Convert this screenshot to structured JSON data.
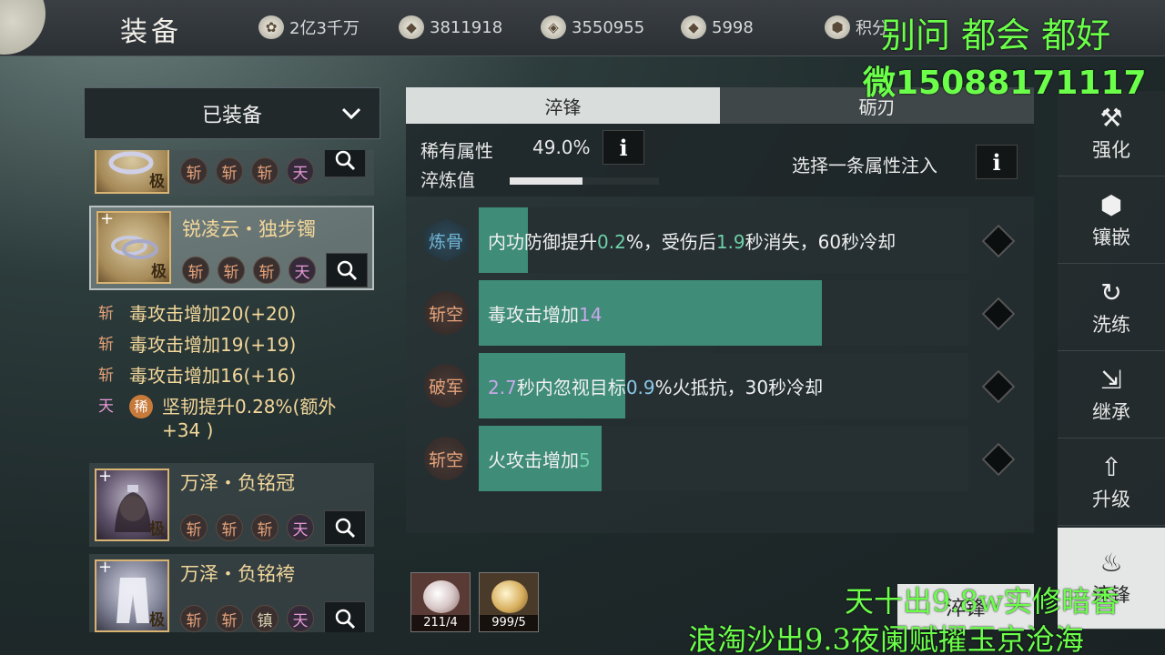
{
  "header": {
    "title": "装备",
    "currencies": [
      {
        "icon": "coin-icon",
        "glyph": "✿",
        "value": "2亿3千万"
      },
      {
        "icon": "silver-ingot-icon",
        "glyph": "◆",
        "value": "3811918"
      },
      {
        "icon": "jade-icon",
        "glyph": "◈",
        "value": "3550955"
      },
      {
        "icon": "gold-ingot-icon",
        "glyph": "◆",
        "value": "5998"
      },
      {
        "icon": "points-icon",
        "glyph": "⬢",
        "value": "积分"
      }
    ]
  },
  "left": {
    "dropdown_label": "已装备",
    "items": [
      {
        "name": "",
        "grade": "极",
        "slots": [
          "斩",
          "斩",
          "斩",
          "天"
        ]
      },
      {
        "name": "锐凌云・独步镯",
        "grade": "极",
        "slots": [
          "斩",
          "斩",
          "斩",
          "天"
        ]
      },
      {
        "name": "万泽・负铭冠",
        "grade": "极",
        "slots": [
          "斩",
          "斩",
          "斩",
          "天"
        ]
      },
      {
        "name": "万泽・负铭袴",
        "grade": "极",
        "slots": [
          "斩",
          "斩",
          "镇",
          "天"
        ]
      }
    ],
    "stats": [
      {
        "tag": "斩",
        "text": "毒攻击增加20(+20)"
      },
      {
        "tag": "斩",
        "text": "毒攻击增加19(+19)"
      },
      {
        "tag": "斩",
        "text": "毒攻击增加16(+16)"
      },
      {
        "tag": "天",
        "rare": "稀",
        "text": "坚韧提升0.28%(额外+34 )"
      }
    ]
  },
  "center": {
    "tabs": [
      "淬锋",
      "砺刃"
    ],
    "rare_attr_label": "稀有属性",
    "rare_attr_value": "49.0%",
    "temper_label": "淬炼值",
    "temper_progress": 0.49,
    "select_hint": "选择一条属性注入",
    "info_glyph": "i",
    "rows": [
      {
        "label": "炼骨",
        "fill": 0.1,
        "parts": [
          [
            "内功防御提升",
            ""
          ],
          [
            "0.2",
            "g"
          ],
          [
            "%，受伤后",
            ""
          ],
          [
            "1.9",
            "g"
          ],
          [
            "秒消失，60秒冷却",
            ""
          ]
        ]
      },
      {
        "label": "斩空",
        "fill": 0.7,
        "parts": [
          [
            "毒攻击增加",
            ""
          ],
          [
            "14",
            "p"
          ]
        ]
      },
      {
        "label": "破军",
        "fill": 0.3,
        "parts": [
          [
            "2.7",
            "p"
          ],
          [
            "秒内忽视目标",
            ""
          ],
          [
            "0.9",
            "b"
          ],
          [
            "%火抵抗，30秒冷却",
            ""
          ]
        ]
      },
      {
        "label": "斩空",
        "fill": 0.25,
        "parts": [
          [
            "火攻击增加",
            ""
          ],
          [
            "5",
            "g"
          ]
        ]
      }
    ],
    "materials": [
      {
        "count": "211/4"
      },
      {
        "count": "999/5"
      }
    ],
    "confirm_label": "淬锋"
  },
  "right_nav": [
    {
      "label": "强化",
      "glyph": "⚒"
    },
    {
      "label": "镶嵌",
      "glyph": "⬢"
    },
    {
      "label": "洗练",
      "glyph": "↻"
    },
    {
      "label": "继承",
      "glyph": "⇲"
    },
    {
      "label": "升级",
      "glyph": "⇧"
    },
    {
      "label": "淬锋",
      "glyph": "♨"
    }
  ],
  "overlays": {
    "line1": "别问 都会 都好",
    "line2": "微15088171117",
    "line3": "天十出9.8w实修暗香",
    "line4": "浪淘沙出9.3夜阑赋擢玉京沧海"
  }
}
